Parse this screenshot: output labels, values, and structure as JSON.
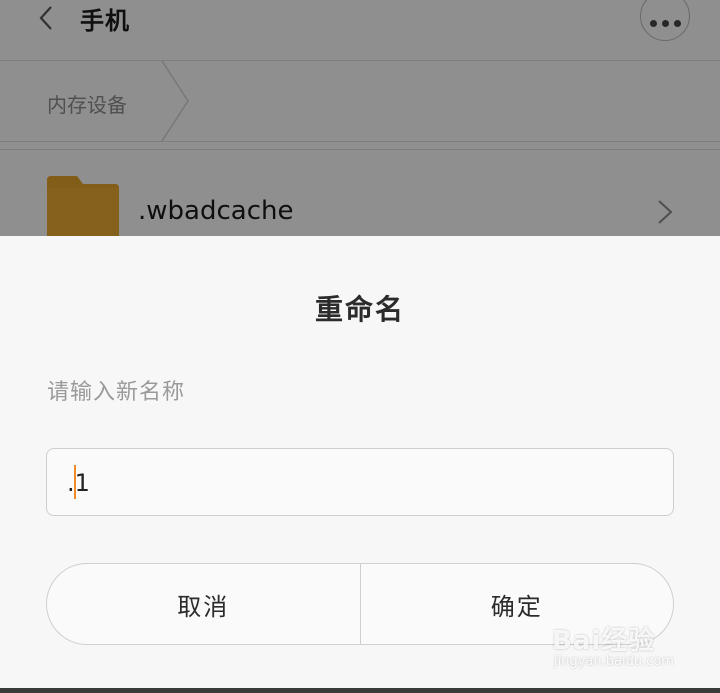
{
  "header": {
    "title": "手机",
    "back_icon": "chevron-left-icon",
    "more_icon": "more-dots-icon"
  },
  "breadcrumb": {
    "items": [
      "内存设备"
    ]
  },
  "file_list": {
    "items": [
      {
        "name": ".wbadcache",
        "icon": "folder-icon",
        "color": "#e0a02a"
      }
    ]
  },
  "dialog": {
    "title": "重命名",
    "hint": "请输入新名称",
    "input_value": ".1",
    "caret_color": "#f08a24",
    "cancel_label": "取消",
    "confirm_label": "确定"
  },
  "watermark": {
    "logo": "Bai经验",
    "url": "jingyan.baidu.com"
  }
}
